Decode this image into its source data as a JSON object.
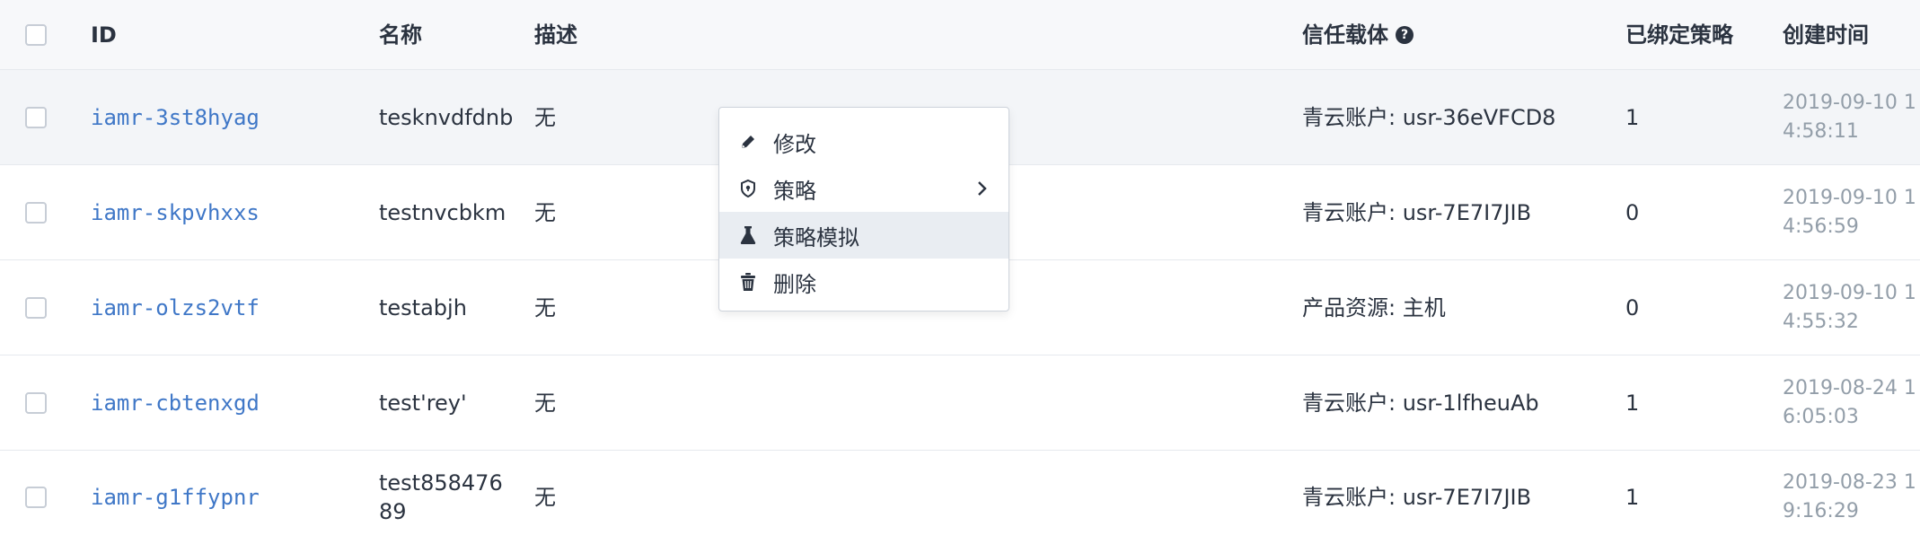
{
  "table": {
    "headers": {
      "id": "ID",
      "name": "名称",
      "description": "描述",
      "trust": "信任载体",
      "bound_policies": "已绑定策略",
      "created": "创建时间"
    },
    "rows": [
      {
        "id": "iamr-3st8hyag",
        "name": "tesknvdfdnb",
        "description": "无",
        "trust": "青云账户: usr-36eVFCD8",
        "bound": "1",
        "created": "2019-09-10 14:58:11"
      },
      {
        "id": "iamr-skpvhxxs",
        "name": "testnvcbkm",
        "description": "无",
        "trust": "青云账户: usr-7E7I7JIB",
        "bound": "0",
        "created": "2019-09-10 14:56:59"
      },
      {
        "id": "iamr-olzs2vtf",
        "name": "testabjh",
        "description": "无",
        "trust": "产品资源: 主机",
        "bound": "0",
        "created": "2019-09-10 14:55:32"
      },
      {
        "id": "iamr-cbtenxgd",
        "name": "test'rey'",
        "description": "无",
        "trust": "青云账户: usr-1lfheuAb",
        "bound": "1",
        "created": "2019-08-24 16:05:03"
      },
      {
        "id": "iamr-g1ffypnr",
        "name": "test85847689",
        "description": "无",
        "trust": "青云账户: usr-7E7I7JIB",
        "bound": "1",
        "created": "2019-08-23 19:16:29"
      }
    ]
  },
  "context_menu": {
    "items": [
      {
        "label": "修改",
        "icon": "pencil-icon"
      },
      {
        "label": "策略",
        "icon": "shield-icon",
        "has_submenu": true
      },
      {
        "label": "策略模拟",
        "icon": "flask-icon",
        "highlighted": true
      },
      {
        "label": "删除",
        "icon": "trash-icon"
      }
    ]
  },
  "colors": {
    "link": "#3f77c7",
    "muted": "#939ea9",
    "header_bg": "#f7f8fa",
    "hover_bg": "#f3f5f8",
    "menu_active_bg": "#e9edf2"
  }
}
